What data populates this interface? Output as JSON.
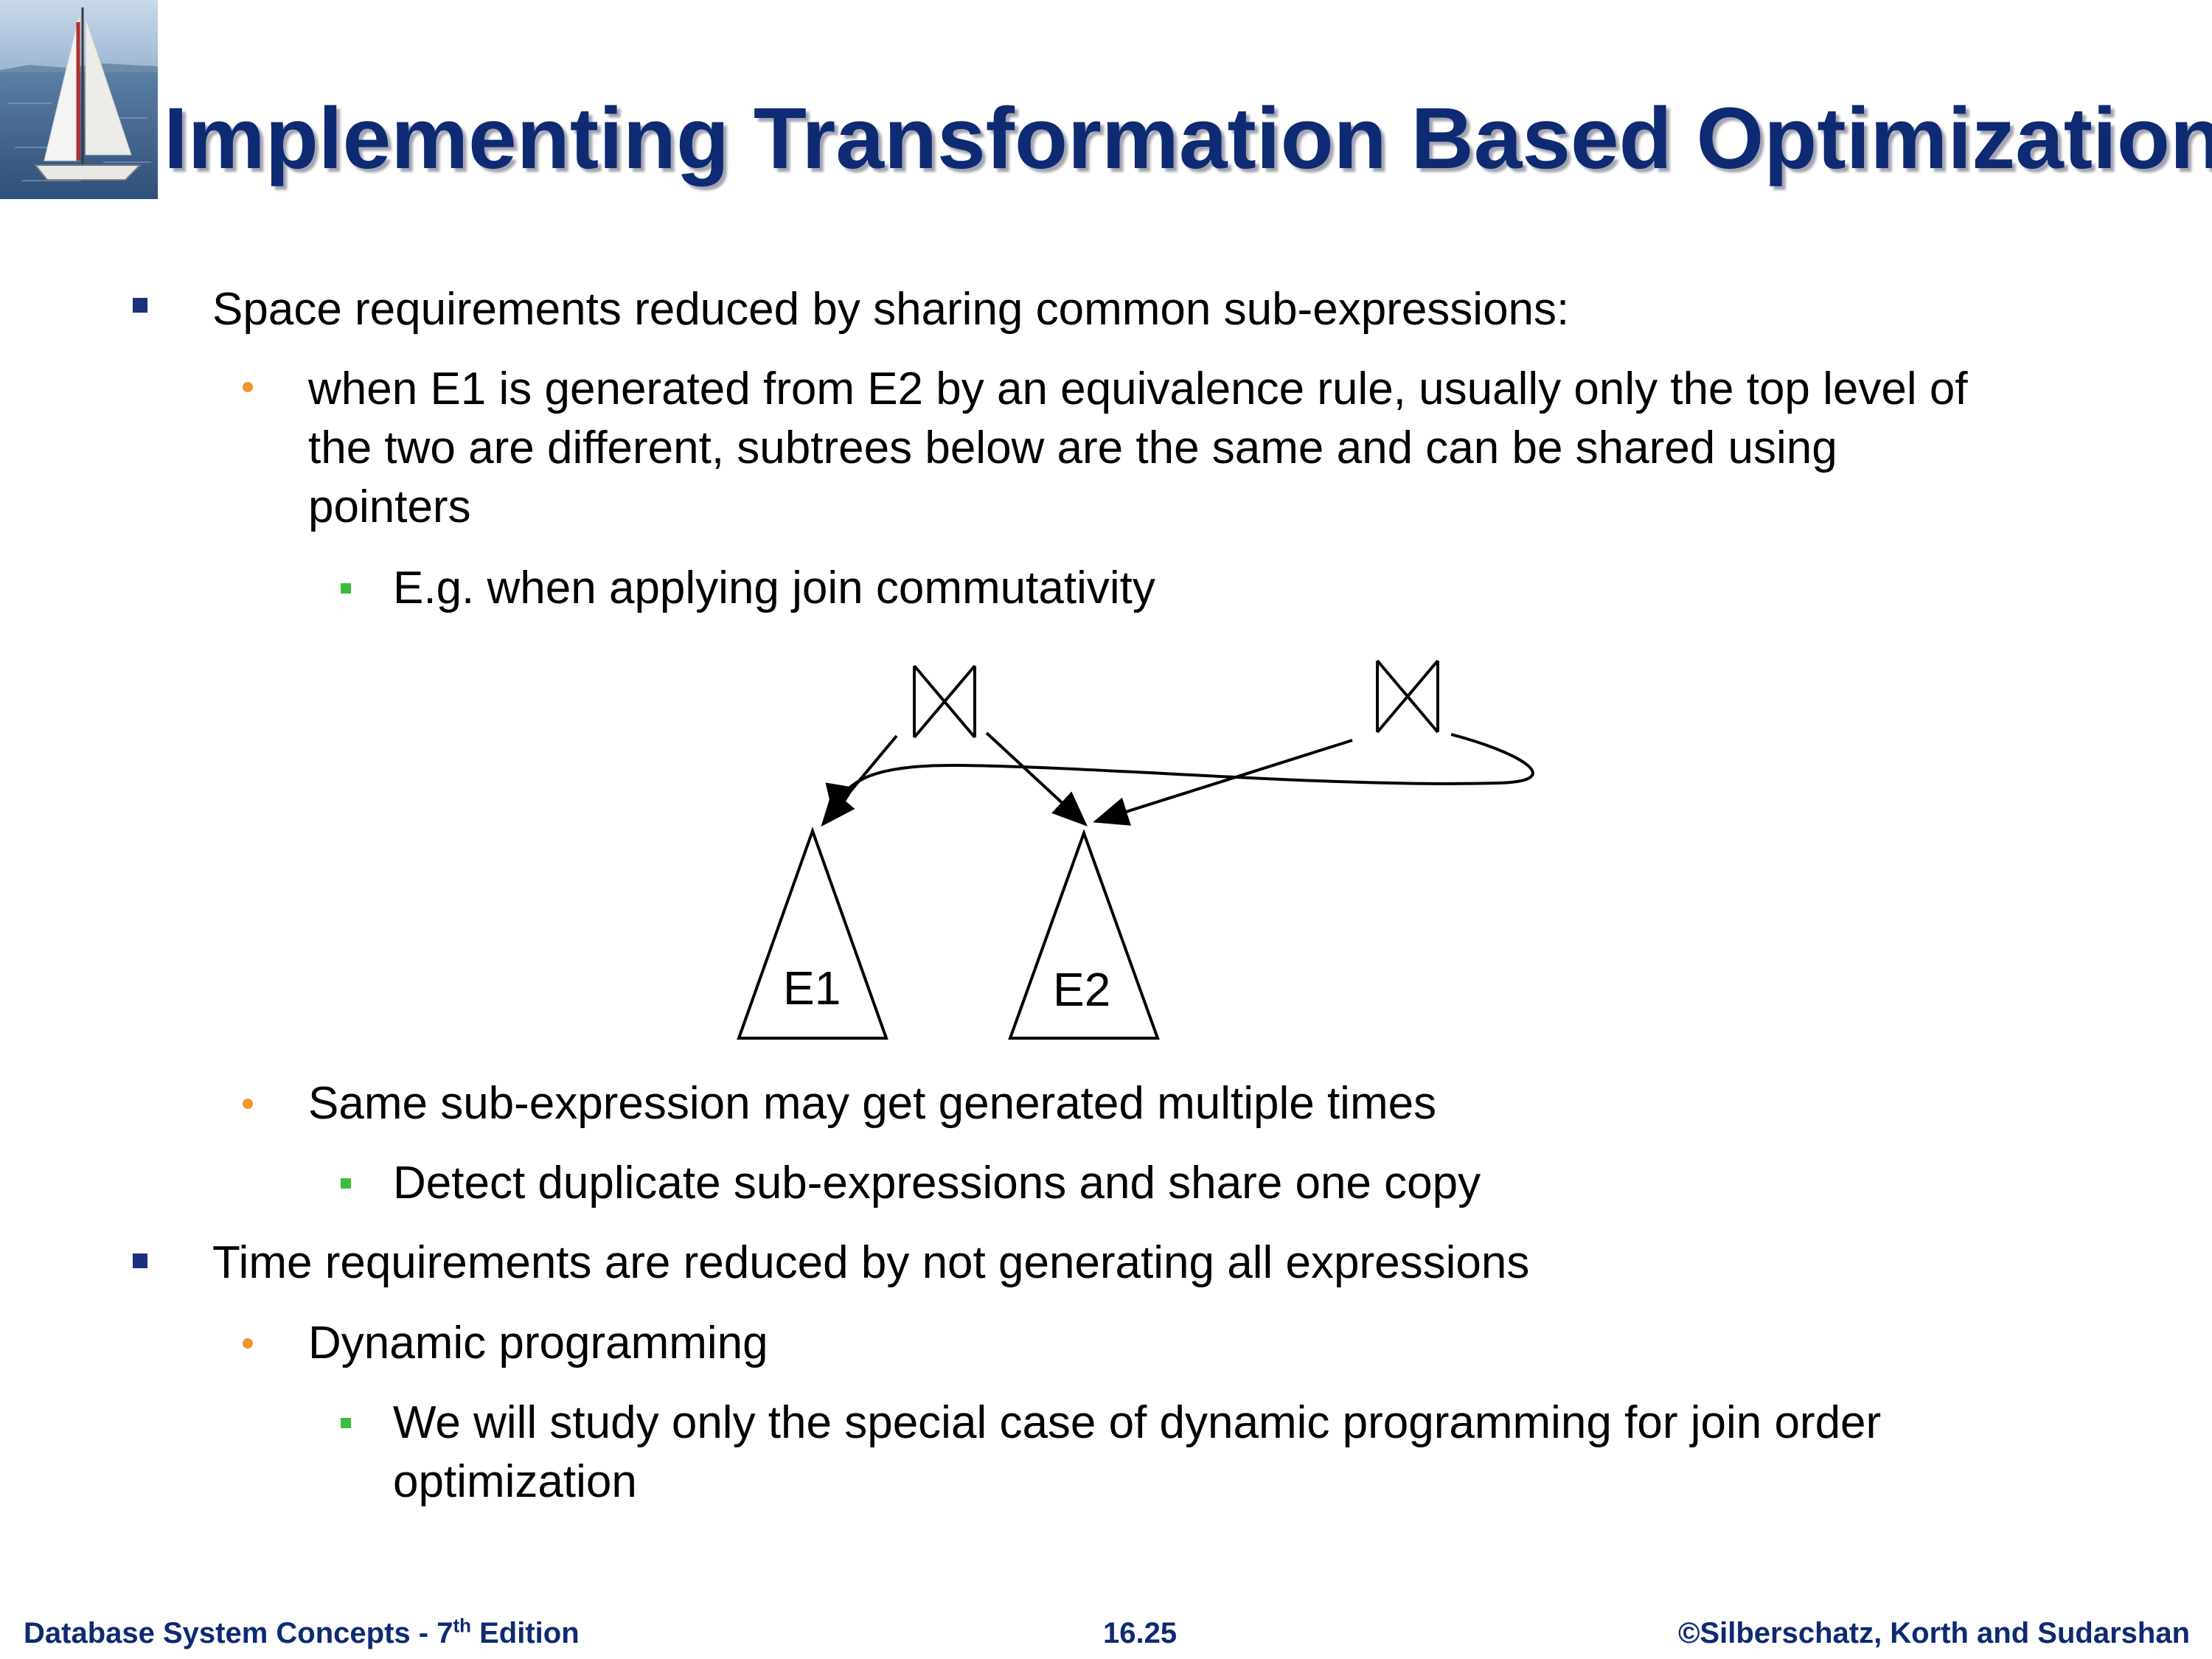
{
  "title": "Implementing Transformation Based Optimization",
  "bullets": [
    {
      "level": 1,
      "lines": [
        "Space requirements reduced by sharing common sub-expressions:"
      ]
    },
    {
      "level": 2,
      "lines": [
        "when E1 is generated from E2 by an equivalence rule, usually only the top level of",
        "the two are different, subtrees below are the same and can be shared using",
        "pointers"
      ]
    },
    {
      "level": 3,
      "lines": [
        "E.g. when applying join commutativity"
      ]
    },
    {
      "level": 2,
      "lines": [
        "Same sub-expression may get generated multiple times"
      ]
    },
    {
      "level": 3,
      "lines": [
        "Detect duplicate sub-expressions and share one copy"
      ]
    },
    {
      "level": 1,
      "lines": [
        "Time requirements are reduced by not generating all expressions"
      ]
    },
    {
      "level": 2,
      "lines": [
        "Dynamic programming"
      ]
    },
    {
      "level": 3,
      "lines": [
        "We will study only the special case of dynamic programming for join order",
        "optimization"
      ]
    }
  ],
  "diagram": {
    "left_subtree_label": "E1",
    "right_subtree_label": "E2",
    "join_symbol": "bowtie-icon"
  },
  "footer": {
    "left_text": "Database System Concepts - 7",
    "left_sup": "th",
    "left_suffix": " Edition",
    "center": "16.25",
    "right": "©Silberschatz, Korth and Sudarshan"
  },
  "colors": {
    "title": "#0d2a73",
    "bullet_level_1": "#1b2f7a",
    "bullet_level_2": "#f0962a",
    "bullet_level_3": "#3cbe3c"
  }
}
